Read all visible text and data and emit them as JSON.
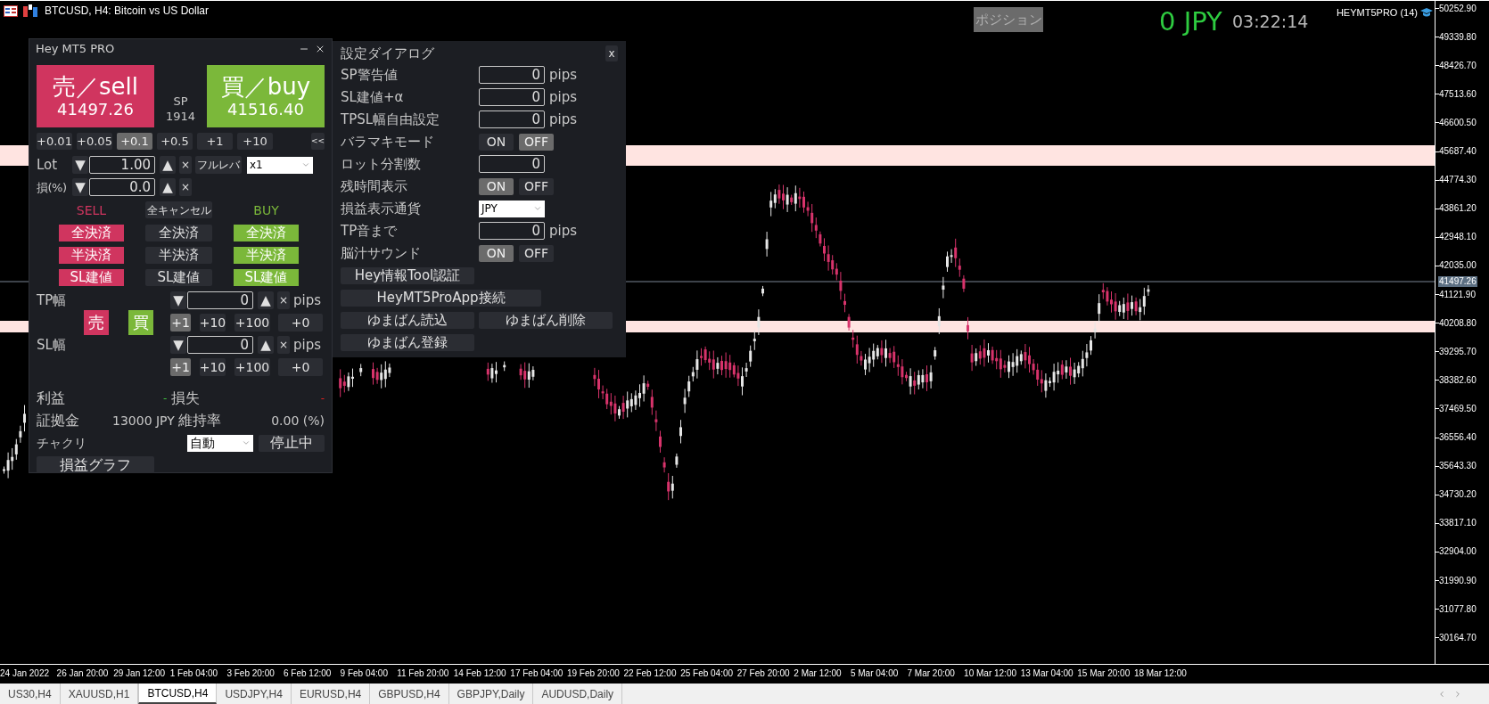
{
  "window": {
    "title": "BTCUSD, H4:  Bitcoin vs US Dollar"
  },
  "overlay": {
    "position_button": "ポジション",
    "profit": "0 JPY",
    "timer": "03:22:14",
    "account": "HEYMT5PRO (14)"
  },
  "price_axis": {
    "labels": [
      "50252.90",
      "49339.80",
      "48426.70",
      "47513.60",
      "46600.50",
      "45687.40",
      "44774.30",
      "43861.20",
      "42948.10",
      "42035.00",
      "41121.90",
      "40208.80",
      "39295.70",
      "38382.60",
      "37469.50",
      "36556.40",
      "35643.30",
      "34730.20",
      "33817.10",
      "32904.00",
      "31990.90",
      "31077.80",
      "30164.70"
    ],
    "current_price": "41497.26"
  },
  "time_axis": {
    "labels": [
      "24 Jan 2022",
      "26 Jan 20:00",
      "29 Jan 12:00",
      "1 Feb 04:00",
      "3 Feb 20:00",
      "6 Feb 12:00",
      "9 Feb 04:00",
      "11 Feb 20:00",
      "14 Feb 12:00",
      "17 Feb 04:00",
      "19 Feb 20:00",
      "22 Feb 12:00",
      "25 Feb 04:00",
      "27 Feb 20:00",
      "2 Mar 12:00",
      "5 Mar 04:00",
      "7 Mar 20:00",
      "10 Mar 12:00",
      "13 Mar 04:00",
      "15 Mar 20:00",
      "18 Mar 12:00"
    ]
  },
  "symbol_tabs": [
    {
      "label": "US30,H4",
      "selected": false
    },
    {
      "label": "XAUUSD,H1",
      "selected": false
    },
    {
      "label": "BTCUSD,H4",
      "selected": true
    },
    {
      "label": "USDJPY,H4",
      "selected": false
    },
    {
      "label": "EURUSD,H4",
      "selected": false
    },
    {
      "label": "GBPUSD,H4",
      "selected": false
    },
    {
      "label": "GBPJPY,Daily",
      "selected": false
    },
    {
      "label": "AUDUSD,Daily",
      "selected": false
    }
  ],
  "trade_panel": {
    "title": "Hey MT5 PRO",
    "sell": {
      "label": "売／sell",
      "price": "41497.26"
    },
    "spread": {
      "label": "SP",
      "value": "1914"
    },
    "buy": {
      "label": "買／buy",
      "price": "41516.40"
    },
    "lot_steps": [
      {
        "label": "+0.01",
        "selected": false
      },
      {
        "label": "+0.05",
        "selected": false
      },
      {
        "label": "+0.1",
        "selected": true
      },
      {
        "label": "+0.5",
        "selected": false
      },
      {
        "label": "+1",
        "selected": false
      },
      {
        "label": "+10",
        "selected": false
      }
    ],
    "collapse": "<<",
    "lot": {
      "label": "Lot",
      "down": "▼",
      "value": "1.00",
      "up": "▲",
      "clear": "×",
      "leverage_button": "フルレバ",
      "leverage": "x1"
    },
    "risk": {
      "label": "損(%)",
      "down": "▼",
      "value": "0.0",
      "up": "▲",
      "clear": "×"
    },
    "sell_header": "SELL",
    "cancel_all": "全キャンセル",
    "buy_header": "BUY",
    "close_rows": [
      {
        "sell": "全決済",
        "all": "全決済",
        "buy": "全決済"
      },
      {
        "sell": "半決済",
        "all": "半決済",
        "buy": "半決済"
      },
      {
        "sell": "SL建値",
        "all": "SL建値",
        "buy": "SL建値"
      }
    ],
    "tp": {
      "label": "TP幅",
      "sell": "売",
      "buy": "買",
      "down": "▼",
      "value": "0",
      "up": "▲",
      "clear": "×",
      "unit": "pips",
      "steps": [
        {
          "label": "+1",
          "selected": true
        },
        {
          "label": "+10",
          "selected": false
        },
        {
          "label": "+100",
          "selected": false
        },
        {
          "label": "+0",
          "selected": false
        }
      ]
    },
    "sl": {
      "label": "SL幅",
      "down": "▼",
      "value": "0",
      "up": "▲",
      "clear": "×",
      "unit": "pips",
      "steps": [
        {
          "label": "+1",
          "selected": true
        },
        {
          "label": "+10",
          "selected": false
        },
        {
          "label": "+100",
          "selected": false
        },
        {
          "label": "+0",
          "selected": false
        }
      ]
    },
    "profit": {
      "label": "利益",
      "value": "-"
    },
    "loss": {
      "label": "損失",
      "value": "-"
    },
    "margin": {
      "label": "証拠金",
      "value": "13000 JPY"
    },
    "margin_ratio": {
      "label": "維持率",
      "value": "0.00 (%)"
    },
    "chakuri": {
      "label": "チャクリ",
      "mode": "自動",
      "status": "停止中"
    },
    "graph_button": "損益グラフ"
  },
  "settings_dialog": {
    "title": "設定ダイアログ",
    "close": "x",
    "rows": [
      {
        "kind": "input",
        "label": "SP警告値",
        "value": "0",
        "unit": "pips"
      },
      {
        "kind": "input",
        "label": "SL建値+α",
        "value": "0",
        "unit": "pips"
      },
      {
        "kind": "input",
        "label": "TPSL幅自由設定",
        "value": "0",
        "unit": "pips"
      },
      {
        "kind": "toggle",
        "label": "バラマキモード",
        "on_label": "ON",
        "off_label": "OFF",
        "on": false
      },
      {
        "kind": "input",
        "label": "ロット分割数",
        "value": "0"
      },
      {
        "kind": "toggle",
        "label": "残時間表示",
        "on_label": "ON",
        "off_label": "OFF",
        "on": true
      },
      {
        "kind": "select",
        "label": "損益表示通貨",
        "value": "JPY"
      },
      {
        "kind": "input",
        "label": "TP音まで",
        "value": "0",
        "unit": "pips"
      },
      {
        "kind": "toggle",
        "label": "脳汁サウンド",
        "on_label": "ON",
        "off_label": "OFF",
        "on": true
      }
    ],
    "button_rows": [
      [
        {
          "label": "Hey情報Tool認証"
        }
      ],
      [
        {
          "label": "HeyMT5ProApp接続"
        }
      ],
      [
        {
          "label": "ゆまばん読込"
        },
        {
          "label": "ゆまばん削除"
        }
      ],
      [
        {
          "label": "ゆまばん登録"
        }
      ]
    ]
  }
}
